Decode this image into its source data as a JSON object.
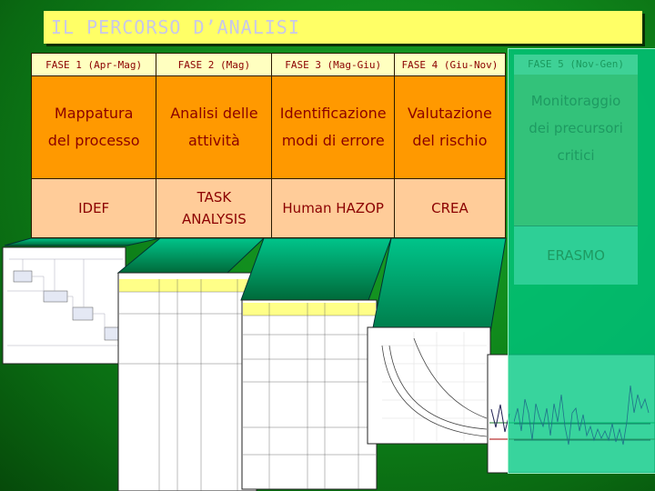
{
  "title": "IL PERCORSO D’ANALISI",
  "phases": [
    {
      "header": "FASE 1 (Apr-Mag)",
      "activity": [
        "Mappatura",
        "del processo"
      ],
      "method": [
        "IDEF"
      ]
    },
    {
      "header": "FASE 2 (Mag)",
      "activity": [
        "Analisi delle",
        "attività"
      ],
      "method": [
        "TASK",
        "ANALYSIS"
      ]
    },
    {
      "header": "FASE 3 (Mag-Giu)",
      "activity": [
        "Identificazione",
        "modi di errore"
      ],
      "method": [
        "Human HAZOP"
      ]
    },
    {
      "header": "FASE 4 (Giu-Nov)",
      "activity": [
        "Valutazione",
        "del rischio"
      ],
      "method": [
        "CREA"
      ]
    },
    {
      "header": "FASE 5 (Nov-Gen)",
      "activity": [
        "Monitoraggio",
        "dei precursori",
        "critici"
      ],
      "method": [
        "ERASMO"
      ]
    }
  ],
  "thumbnails": [
    "idef-diagram",
    "task-analysis-table",
    "human-hazop-table",
    "crea-risk-chart",
    "erasmo-control-chart"
  ]
}
